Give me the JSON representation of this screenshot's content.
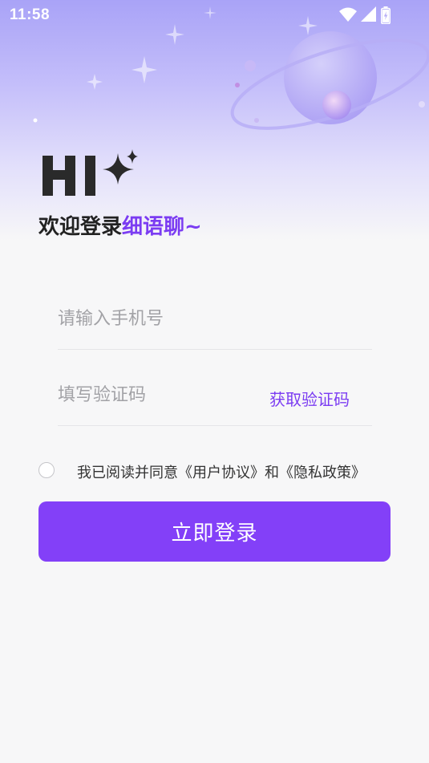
{
  "status_bar": {
    "time": "11:58",
    "icons": [
      "wifi-icon",
      "cellular-signal-icon",
      "battery-charging-icon"
    ]
  },
  "header": {
    "logo_text": "HI",
    "welcome_prefix": "欢迎登录",
    "brand_name": "细语聊~"
  },
  "form": {
    "phone_placeholder": "请输入手机号",
    "phone_value": "",
    "code_placeholder": "填写验证码",
    "code_value": "",
    "get_code_label": "获取验证码"
  },
  "agreement": {
    "checked": false,
    "prefix": "我已阅读并同意",
    "user_agreement": "《用户协议》",
    "conjunction": "和",
    "privacy_policy": "《隐私政策》"
  },
  "login_button_label": "立即登录",
  "colors": {
    "accent": "#8340f8",
    "brand_text": "#7b3cf2",
    "background": "#f7f7f8"
  }
}
